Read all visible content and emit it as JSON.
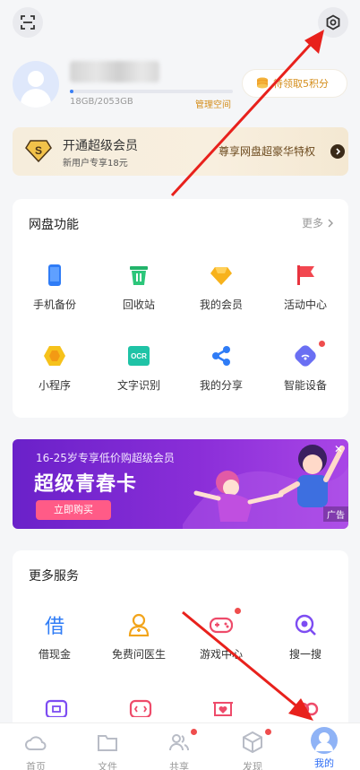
{
  "profile": {
    "storage_text": "18GB/2053GB",
    "storage_used_fraction": 0.009,
    "manage_label": "管理空间",
    "points_label": "待领取5积分"
  },
  "vip": {
    "title": "开通超级会员",
    "subtitle": "新用户专享18元",
    "promo": "尊享网盘超豪华特权"
  },
  "netdisk": {
    "title": "网盘功能",
    "more": "更多",
    "items": [
      {
        "label": "手机备份",
        "icon": "phone-backup-icon"
      },
      {
        "label": "回收站",
        "icon": "recycle-bin-icon"
      },
      {
        "label": "我的会员",
        "icon": "diamond-icon"
      },
      {
        "label": "活动中心",
        "icon": "flag-icon"
      },
      {
        "label": "小程序",
        "icon": "mini-program-icon"
      },
      {
        "label": "文字识别",
        "icon": "ocr-icon",
        "icon_text": "OCR"
      },
      {
        "label": "我的分享",
        "icon": "share-icon"
      },
      {
        "label": "智能设备",
        "icon": "smart-device-icon"
      }
    ]
  },
  "banner": {
    "line1": "16-25岁专享低价购超级会员",
    "line2": "超级青春卡",
    "button": "立即购买",
    "ad": "广告"
  },
  "services": {
    "title": "更多服务",
    "items": [
      {
        "label": "借现金",
        "icon": "loan-icon",
        "icon_text": "借"
      },
      {
        "label": "免费问医生",
        "icon": "doctor-icon"
      },
      {
        "label": "游戏中心",
        "icon": "gamepad-icon"
      },
      {
        "label": "搜一搜",
        "icon": "search-icon"
      }
    ]
  },
  "tabs": [
    {
      "label": "首页"
    },
    {
      "label": "文件"
    },
    {
      "label": "共享"
    },
    {
      "label": "发现"
    },
    {
      "label": "我的"
    }
  ],
  "colors": {
    "accent": "#2f6ef5",
    "gold": "#d48d1a",
    "annotation_arrow": "#e8211c",
    "badge_dot": "#ef4d4d"
  }
}
